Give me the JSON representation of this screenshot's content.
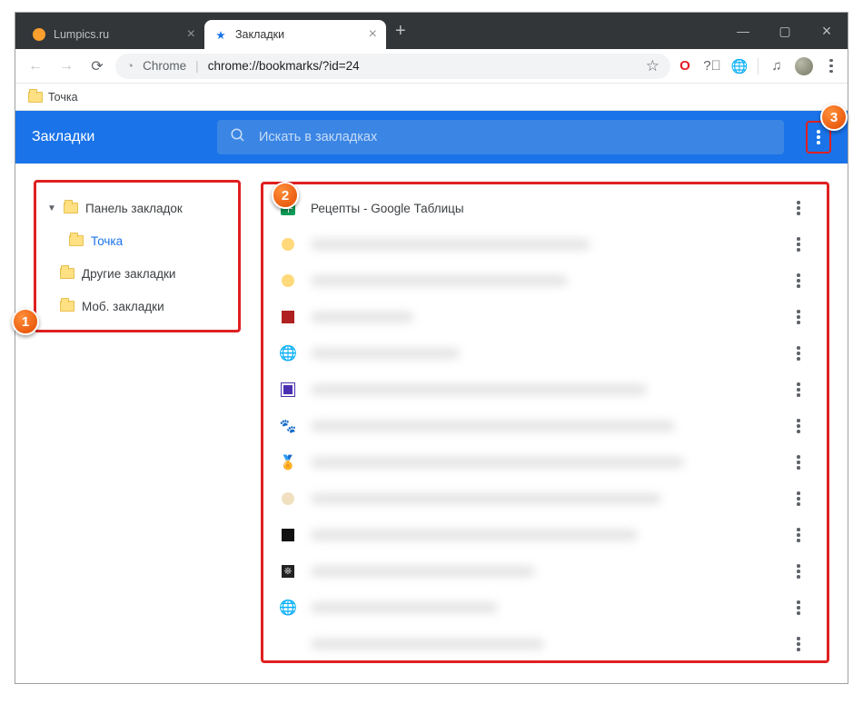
{
  "tabs": [
    {
      "title": "Lumpics.ru",
      "active": false,
      "favicon": "orange-dot"
    },
    {
      "title": "Закладки",
      "active": true,
      "favicon": "blue-star"
    }
  ],
  "toolbar": {
    "chrome_label": "Chrome",
    "url": "chrome://bookmarks/?id=24"
  },
  "bookmarks_bar": {
    "items": [
      {
        "label": "Точка"
      }
    ]
  },
  "manager": {
    "title": "Закладки",
    "search_placeholder": "Искать в закладках",
    "sidebar": {
      "root": "Панель закладок",
      "items": [
        {
          "label": "Точка",
          "selected": true
        },
        {
          "label": "Другие закладки",
          "selected": false
        },
        {
          "label": "Моб. закладки",
          "selected": false
        }
      ]
    },
    "list": [
      {
        "title": "Рецепты - Google Таблицы",
        "icon": "sheets",
        "blurred": false
      },
      {
        "title": "",
        "icon": "yellow-dot",
        "blurred": true,
        "width": "60%"
      },
      {
        "title": "",
        "icon": "yellow-dot",
        "blurred": true,
        "width": "55%"
      },
      {
        "title": "",
        "icon": "red-square",
        "blurred": true,
        "width": "22%"
      },
      {
        "title": "",
        "icon": "globe",
        "blurred": true,
        "width": "32%"
      },
      {
        "title": "",
        "icon": "purple-square",
        "blurred": true,
        "width": "72%"
      },
      {
        "title": "",
        "icon": "paw",
        "blurred": true,
        "width": "78%"
      },
      {
        "title": "",
        "icon": "badge",
        "blurred": true,
        "width": "80%"
      },
      {
        "title": "",
        "icon": "beige-dot",
        "blurred": true,
        "width": "75%"
      },
      {
        "title": "",
        "icon": "black-square",
        "blurred": true,
        "width": "70%"
      },
      {
        "title": "",
        "icon": "leaf-square",
        "blurred": true,
        "width": "48%"
      },
      {
        "title": "",
        "icon": "globe",
        "blurred": true,
        "width": "40%"
      },
      {
        "title": "",
        "icon": "none",
        "blurred": true,
        "width": "50%"
      },
      {
        "title": "",
        "icon": "beige-dot",
        "blurred": true,
        "width": "68%"
      }
    ]
  },
  "callouts": {
    "c1": "1",
    "c2": "2",
    "c3": "3"
  }
}
